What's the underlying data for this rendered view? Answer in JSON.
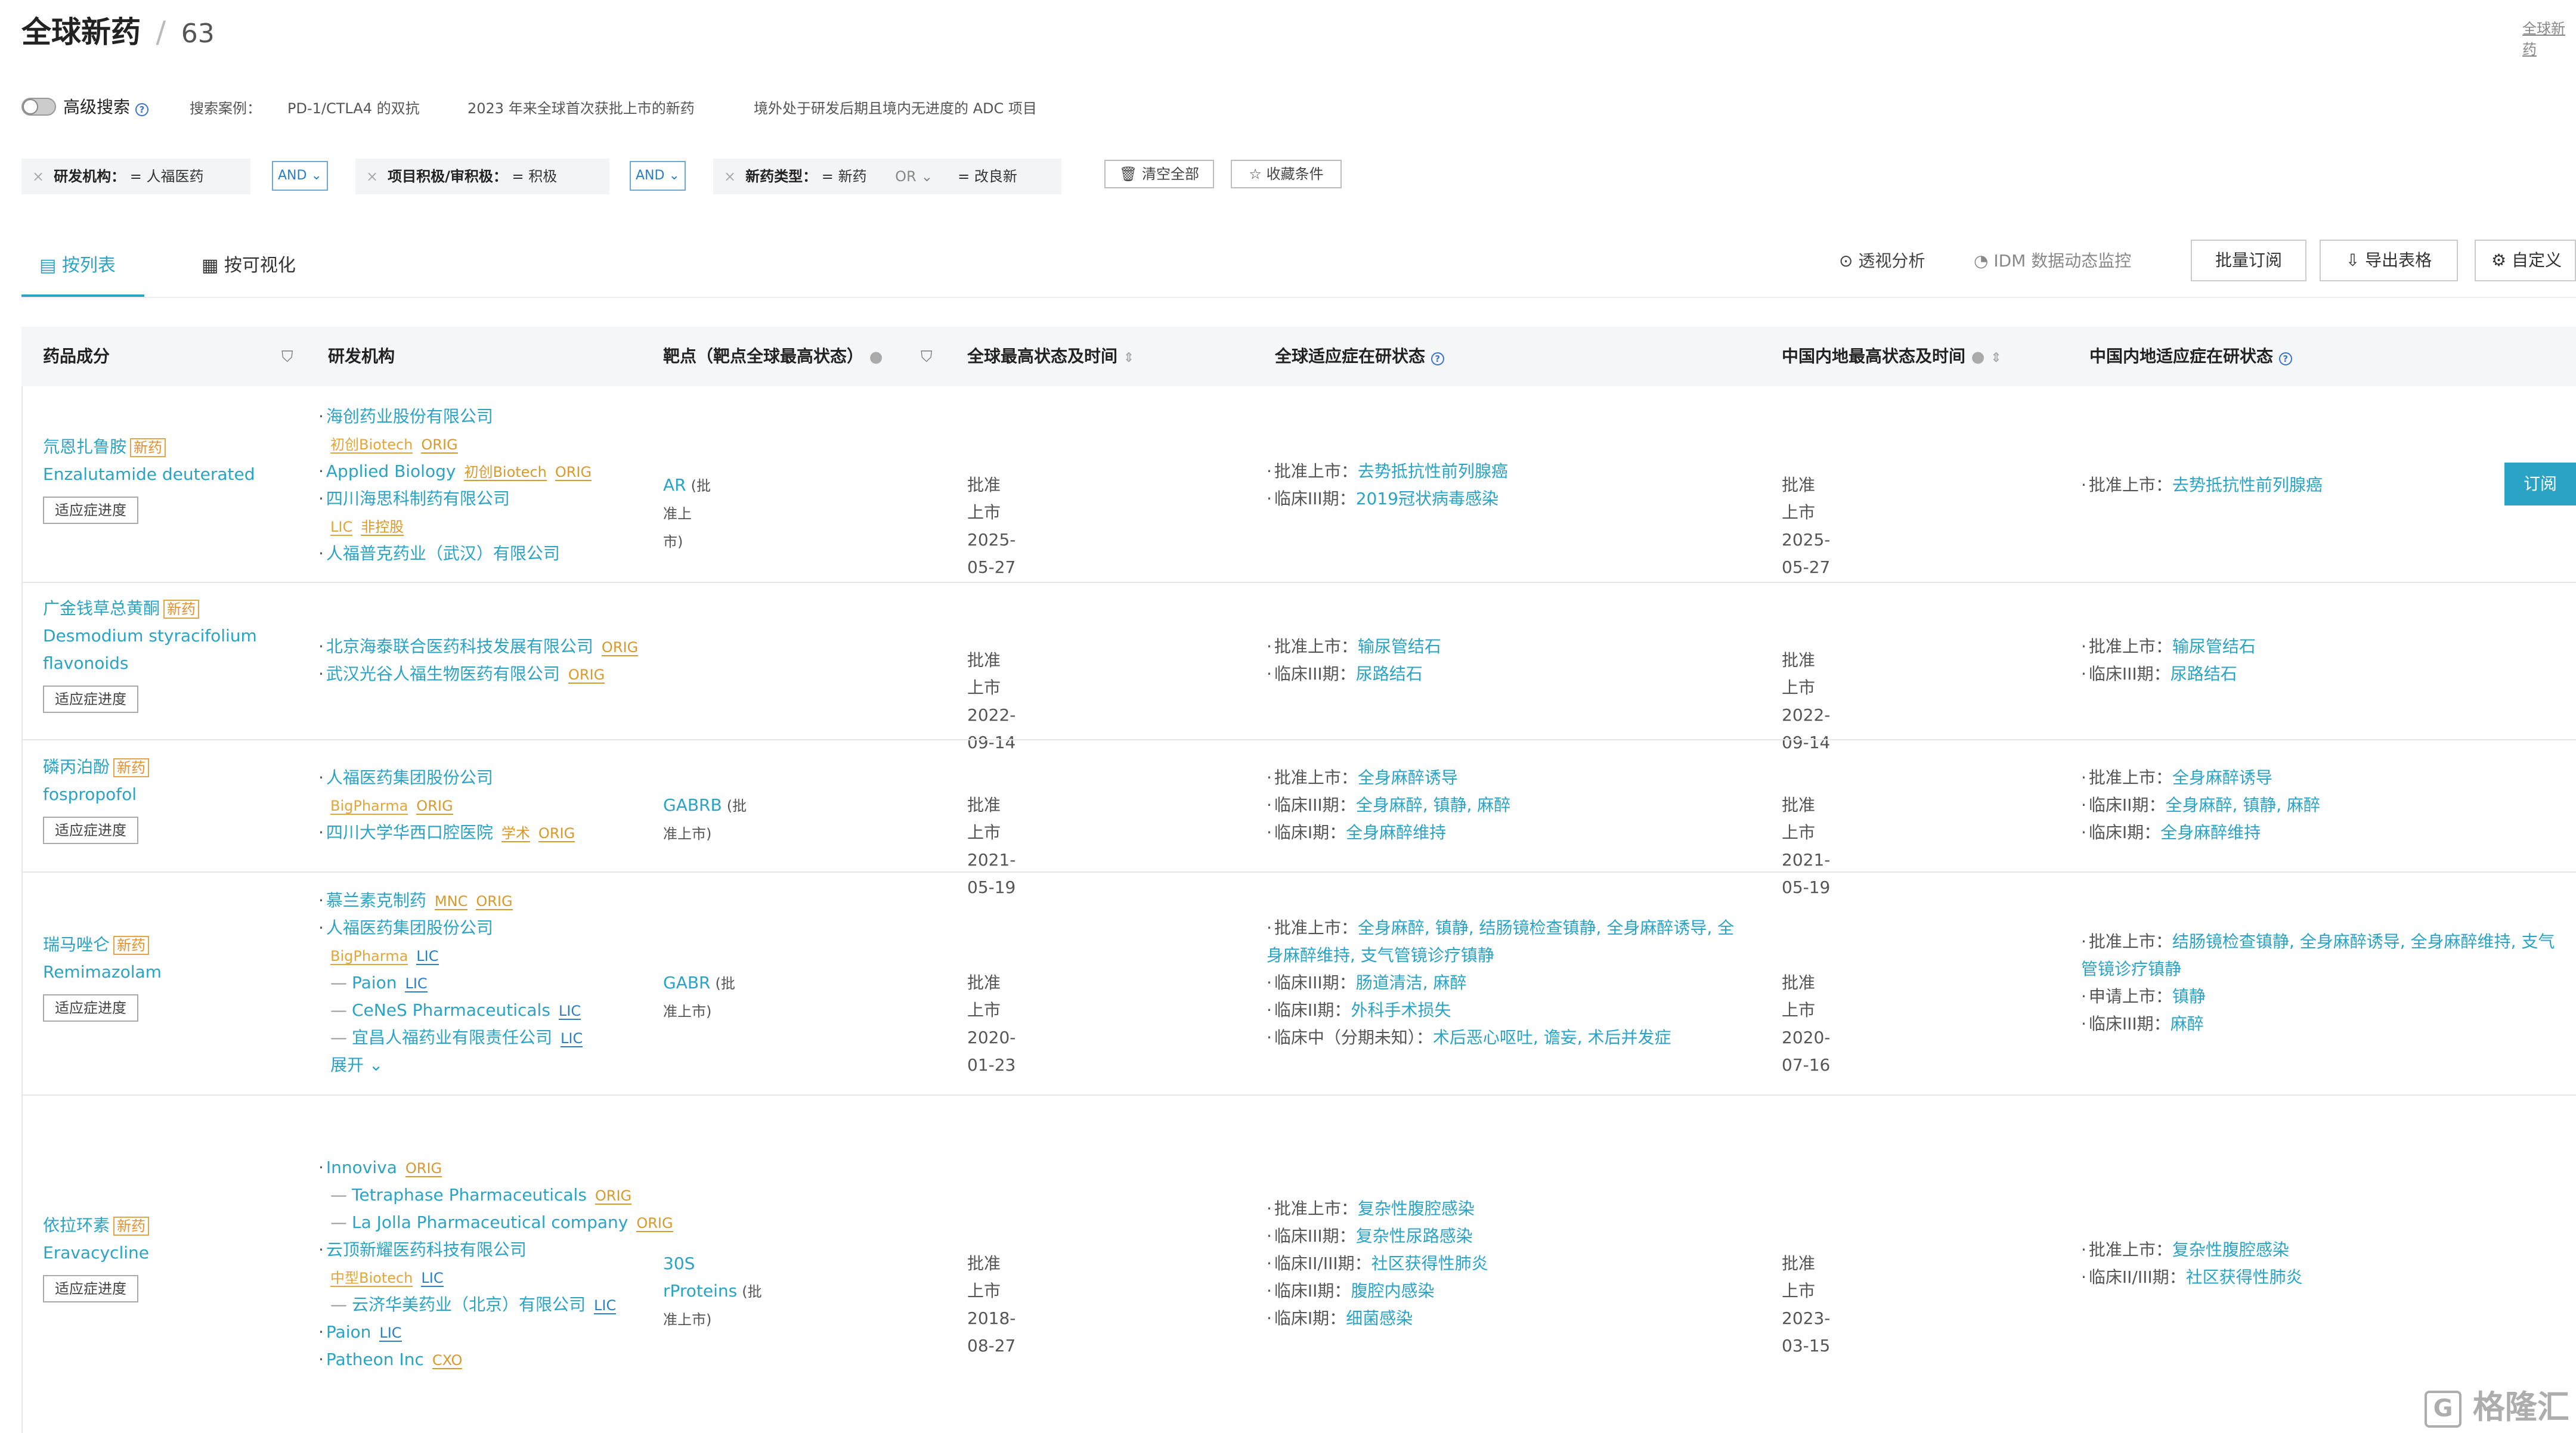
{
  "header": {
    "title": "全球新药",
    "count": "63",
    "top_right_link": "全球新药"
  },
  "search": {
    "advanced_label": "高级搜索",
    "examples_label": "搜索案例：",
    "examples": [
      "PD-1/CTLA4 的双抗",
      "2023 年来全球首次获批上市的新药",
      "境外处于研发后期且境内无进度的 ADC 项目"
    ]
  },
  "filters": {
    "f1_label": "研发机构：",
    "f1_value": "人福医药",
    "and1": "AND",
    "f2_label": "项目积极/审积极：",
    "f2_value": "积极",
    "and2": "AND",
    "f3_label": "新药类型：",
    "f3_value1": "新药",
    "f3_or": "OR",
    "f3_value2": "改良新",
    "clear_all": "清空全部",
    "save_condition": "收藏条件"
  },
  "tabs": {
    "list": "按列表",
    "visual": "按可视化"
  },
  "toolbar": {
    "pivot": "透视分析",
    "idm": "IDM 数据动态监控",
    "batch_subscribe": "批量订阅",
    "export": "导出表格",
    "custom": "自定义"
  },
  "columns": {
    "drug": "药品成分",
    "org": "研发机构",
    "target": "靶点（靶点全球最高状态）",
    "global_status": "全球最高状态及时间",
    "global_ind": "全球适应症在研状态",
    "cn_status": "中国内地最高状态及时间",
    "cn_ind": "中国内地适应症在研状态"
  },
  "new_drug_chip": "新药",
  "indication_btn": "适应症进度",
  "subscribe_btn": "订阅",
  "expand_label": "展开",
  "rows": [
    {
      "drug_cn": "氘恩扎鲁胺",
      "drug_en": "Enzalutamide deuterated",
      "orgs": [
        {
          "name": "海创药业股份有限公司",
          "tags": []
        },
        {
          "name": "初创Biotech",
          "tags": [
            "ORIG"
          ],
          "plain_tag": true
        },
        {
          "name": "Applied Biology",
          "tags": [
            "初创Biotech",
            "ORIG"
          ]
        },
        {
          "name": "四川海思科制药有限公司",
          "tags": []
        },
        {
          "name": "LIC",
          "tags": [
            "非控股"
          ],
          "plain_tag": true
        },
        {
          "name": "人福普克药业（武汉）有限公司",
          "tags": []
        }
      ],
      "target": "AR",
      "target_status": "(批准上市)",
      "global_status": "批准上市 2025-05-27",
      "global_ind": [
        [
          "批准上市：",
          "去势抵抗性前列腺癌"
        ],
        [
          "临床III期：",
          "2019冠状病毒感染"
        ]
      ],
      "cn_status": "批准上市 2025-05-27",
      "cn_ind": [
        [
          "批准上市：",
          "去势抵抗性前列腺癌"
        ]
      ]
    },
    {
      "drug_cn": "广金钱草总黄酮",
      "drug_en": "Desmodium styracifolium flavonoids",
      "orgs": [
        {
          "name": "北京海泰联合医药科技发展有限公司",
          "tags": [
            "ORIG"
          ]
        },
        {
          "name": "武汉光谷人福生物医药有限公司",
          "tags": [
            "ORIG"
          ]
        }
      ],
      "target": "",
      "target_status": "",
      "global_status": "批准上市 2022-09-14",
      "global_ind": [
        [
          "批准上市：",
          "输尿管结石"
        ],
        [
          "临床III期：",
          "尿路结石"
        ]
      ],
      "cn_status": "批准上市 2022-09-14",
      "cn_ind": [
        [
          "批准上市：",
          "输尿管结石"
        ],
        [
          "临床III期：",
          "尿路结石"
        ]
      ]
    },
    {
      "drug_cn": "磷丙泊酚",
      "drug_en": "fospropofol",
      "orgs": [
        {
          "name": "人福医药集团股份公司",
          "tags": []
        },
        {
          "name": "BigPharma",
          "tags": [
            "ORIG"
          ],
          "plain_tag": true
        },
        {
          "name": "四川大学华西口腔医院",
          "tags": [
            "学术",
            "ORIG"
          ]
        }
      ],
      "target": "GABRB",
      "target_status": "(批准上市)",
      "global_status": "批准上市 2021-05-19",
      "global_ind": [
        [
          "批准上市：",
          "全身麻醉诱导"
        ],
        [
          "临床III期：",
          "全身麻醉, 镇静, 麻醉"
        ],
        [
          "临床I期：",
          "全身麻醉维持"
        ]
      ],
      "cn_status": "批准上市 2021-05-19",
      "cn_ind": [
        [
          "批准上市：",
          "全身麻醉诱导"
        ],
        [
          "临床II期：",
          "全身麻醉, 镇静, 麻醉"
        ],
        [
          "临床I期：",
          "全身麻醉维持"
        ]
      ]
    },
    {
      "drug_cn": "瑞马唑仑",
      "drug_en": "Remimazolam",
      "orgs": [
        {
          "name": "慕兰素克制药",
          "tags": [
            "MNC",
            "ORIG"
          ]
        },
        {
          "name": "人福医药集团股份公司",
          "tags": []
        },
        {
          "name": "BigPharma",
          "tags": [
            "LIC"
          ],
          "plain_tag": true
        },
        {
          "name": "Paion",
          "tags": [
            "LIC"
          ],
          "sub": true
        },
        {
          "name": "CeNeS Pharmaceuticals",
          "tags": [
            "LIC"
          ],
          "sub": true
        },
        {
          "name": "宜昌人福药业有限责任公司",
          "tags": [
            "LIC"
          ],
          "sub": true
        }
      ],
      "target": "GABR",
      "target_status": "(批准上市)",
      "global_status": "批准上市 2020-01-23",
      "global_ind": [
        [
          "批准上市：",
          "全身麻醉, 镇静, 结肠镜检查镇静, 全身麻醉诱导, 全身麻醉维持, 支气管镜诊疗镇静"
        ],
        [
          "临床III期：",
          "肠道清洁, 麻醉"
        ],
        [
          "临床II期：",
          "外科手术损失"
        ],
        [
          "临床中（分期未知）：",
          "术后恶心呕吐, 谵妄, 术后并发症"
        ]
      ],
      "cn_status": "批准上市 2020-07-16",
      "cn_ind": [
        [
          "批准上市：",
          "结肠镜检查镇静, 全身麻醉诱导, 全身麻醉维持, 支气管镜诊疗镇静"
        ],
        [
          "申请上市：",
          "镇静"
        ],
        [
          "临床III期：",
          "麻醉"
        ]
      ]
    },
    {
      "drug_cn": "依拉环素",
      "drug_en": "Eravacycline",
      "orgs": [
        {
          "name": "Innoviva",
          "tags": [
            "ORIG"
          ]
        },
        {
          "name": "Tetraphase Pharmaceuticals",
          "tags": [
            "ORIG"
          ],
          "sub": true
        },
        {
          "name": "La Jolla Pharmaceutical company",
          "tags": [
            "ORIG"
          ],
          "sub": true
        },
        {
          "name": "云顶新耀医药科技有限公司",
          "tags": []
        },
        {
          "name": "中型Biotech",
          "tags": [
            "LIC"
          ],
          "plain_tag": true
        },
        {
          "name": "云济华美药业（北京）有限公司",
          "tags": [
            "LIC"
          ],
          "sub": true
        },
        {
          "name": "Paion",
          "tags": [
            "LIC"
          ]
        },
        {
          "name": "Patheon Inc",
          "tags": [
            "CXO"
          ]
        }
      ],
      "target": "30S rProteins",
      "target_status": "(批准上市)",
      "global_status": "批准上市 2018-08-27",
      "global_ind": [
        [
          "批准上市：",
          "复杂性腹腔感染"
        ],
        [
          "临床III期：",
          "复杂性尿路感染"
        ],
        [
          "临床II/III期：",
          "社区获得性肺炎"
        ],
        [
          "临床II期：",
          "腹腔内感染"
        ],
        [
          "临床I期：",
          "细菌感染"
        ]
      ],
      "cn_status": "批准上市 2023-03-15",
      "cn_ind": [
        [
          "批准上市：",
          "复杂性腹腔感染"
        ],
        [
          "临床II/III期：",
          "社区获得性肺炎"
        ]
      ]
    }
  ],
  "watermark": "格隆汇",
  "colors": {
    "accent": "#2aa3c4",
    "tag_orange": "#e39030",
    "tag_blue": "#2b7fc4",
    "subscribe_bg": "#2aa3c4"
  }
}
